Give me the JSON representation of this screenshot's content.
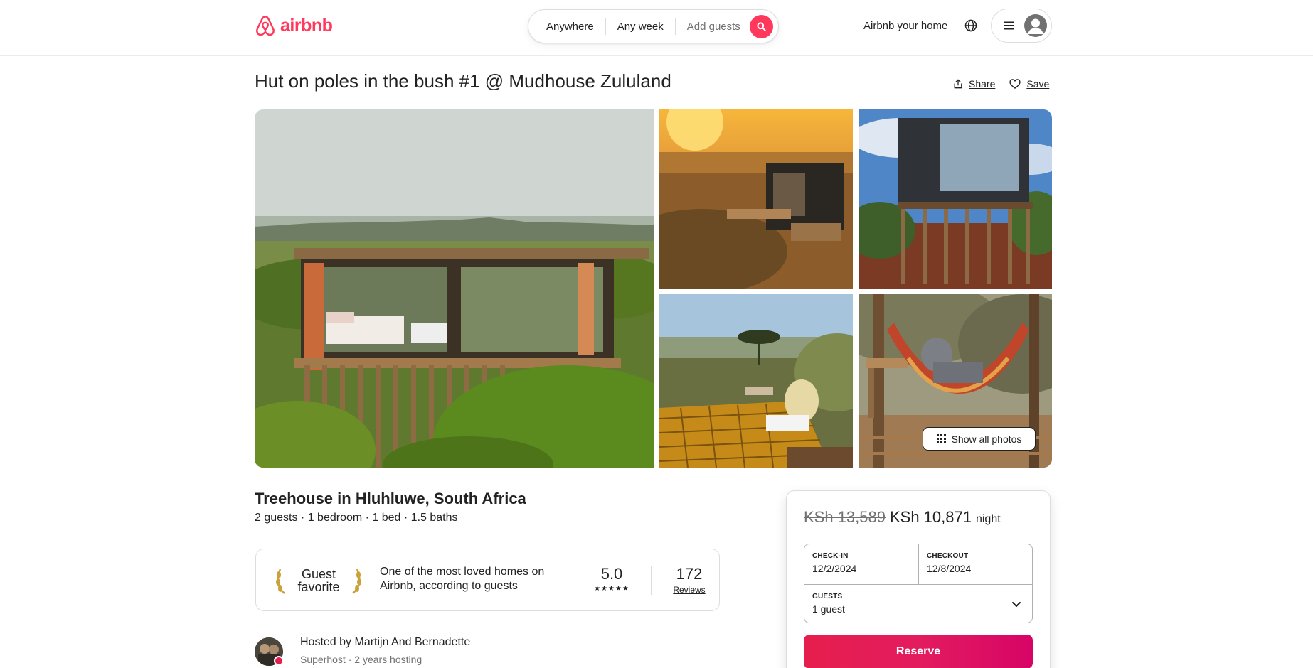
{
  "header": {
    "logo_text": "airbnb",
    "search": {
      "anywhere": "Anywhere",
      "any_week": "Any week",
      "add_guests": "Add guests"
    },
    "host_link": "Airbnb your home",
    "brand_color": "#ff385c"
  },
  "listing": {
    "title": "Hut on poles in the bush #1 @ Mudhouse Zululand",
    "share_label": "Share",
    "save_label": "Save",
    "show_all_photos": "Show all photos",
    "subtitle": "Treehouse in Hluhluwe, South Africa",
    "specs": "2 guests · 1 bedroom · 1 bed · 1.5 baths"
  },
  "guest_favorite": {
    "badge_line1": "Guest",
    "badge_line2": "favorite",
    "description": "One of the most loved homes on Airbnb, according to guests",
    "rating": "5.0",
    "stars": "★★★★★",
    "reviews_count": "172",
    "reviews_label": "Reviews"
  },
  "host": {
    "name": "Hosted by Martijn And Bernadette",
    "meta": "Superhost · 2 years hosting"
  },
  "booking": {
    "price_old": "KSh 13,589",
    "price_new": "KSh 10,871",
    "price_unit": "night",
    "checkin_label": "CHECK-IN",
    "checkin_value": "12/2/2024",
    "checkout_label": "CHECKOUT",
    "checkout_value": "12/8/2024",
    "guests_label": "GUESTS",
    "guests_value": "1 guest",
    "reserve_label": "Reserve"
  }
}
